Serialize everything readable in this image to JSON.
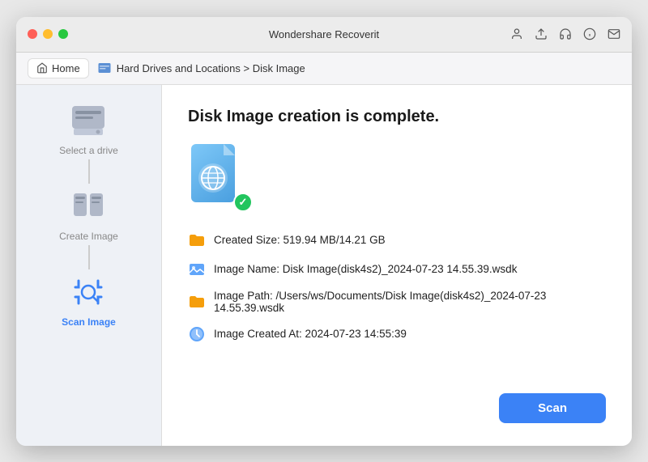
{
  "window": {
    "title": "Wondershare Recoverit"
  },
  "titlebar": {
    "title": "Wondershare Recoverit",
    "icons": [
      "person-icon",
      "refresh-icon",
      "headset-icon",
      "info-icon",
      "mail-icon"
    ]
  },
  "navbar": {
    "home_label": "Home",
    "breadcrumb_text": "Hard Drives and Locations > Disk Image"
  },
  "sidebar": {
    "steps": [
      {
        "label": "Select a drive",
        "active": false
      },
      {
        "label": "Create Image",
        "active": false
      },
      {
        "label": "Scan Image",
        "active": true
      }
    ]
  },
  "content": {
    "title": "Disk Image creation is complete.",
    "info_items": [
      {
        "id": "created-size",
        "text": "Created Size: 519.94 MB/14.21 GB",
        "icon_type": "folder-orange"
      },
      {
        "id": "image-name",
        "text": "Image Name: Disk Image(disk4s2)_2024-07-23 14.55.39.wsdk",
        "icon_type": "image-blue"
      },
      {
        "id": "image-path",
        "text": "Image Path: /Users/ws/Documents/Disk Image(disk4s2)_2024-07-23 14.55.39.wsdk",
        "icon_type": "folder-orange"
      },
      {
        "id": "image-created",
        "text": "Image Created At: 2024-07-23 14:55:39",
        "icon_type": "clock-blue"
      }
    ]
  },
  "buttons": {
    "scan_label": "Scan"
  }
}
